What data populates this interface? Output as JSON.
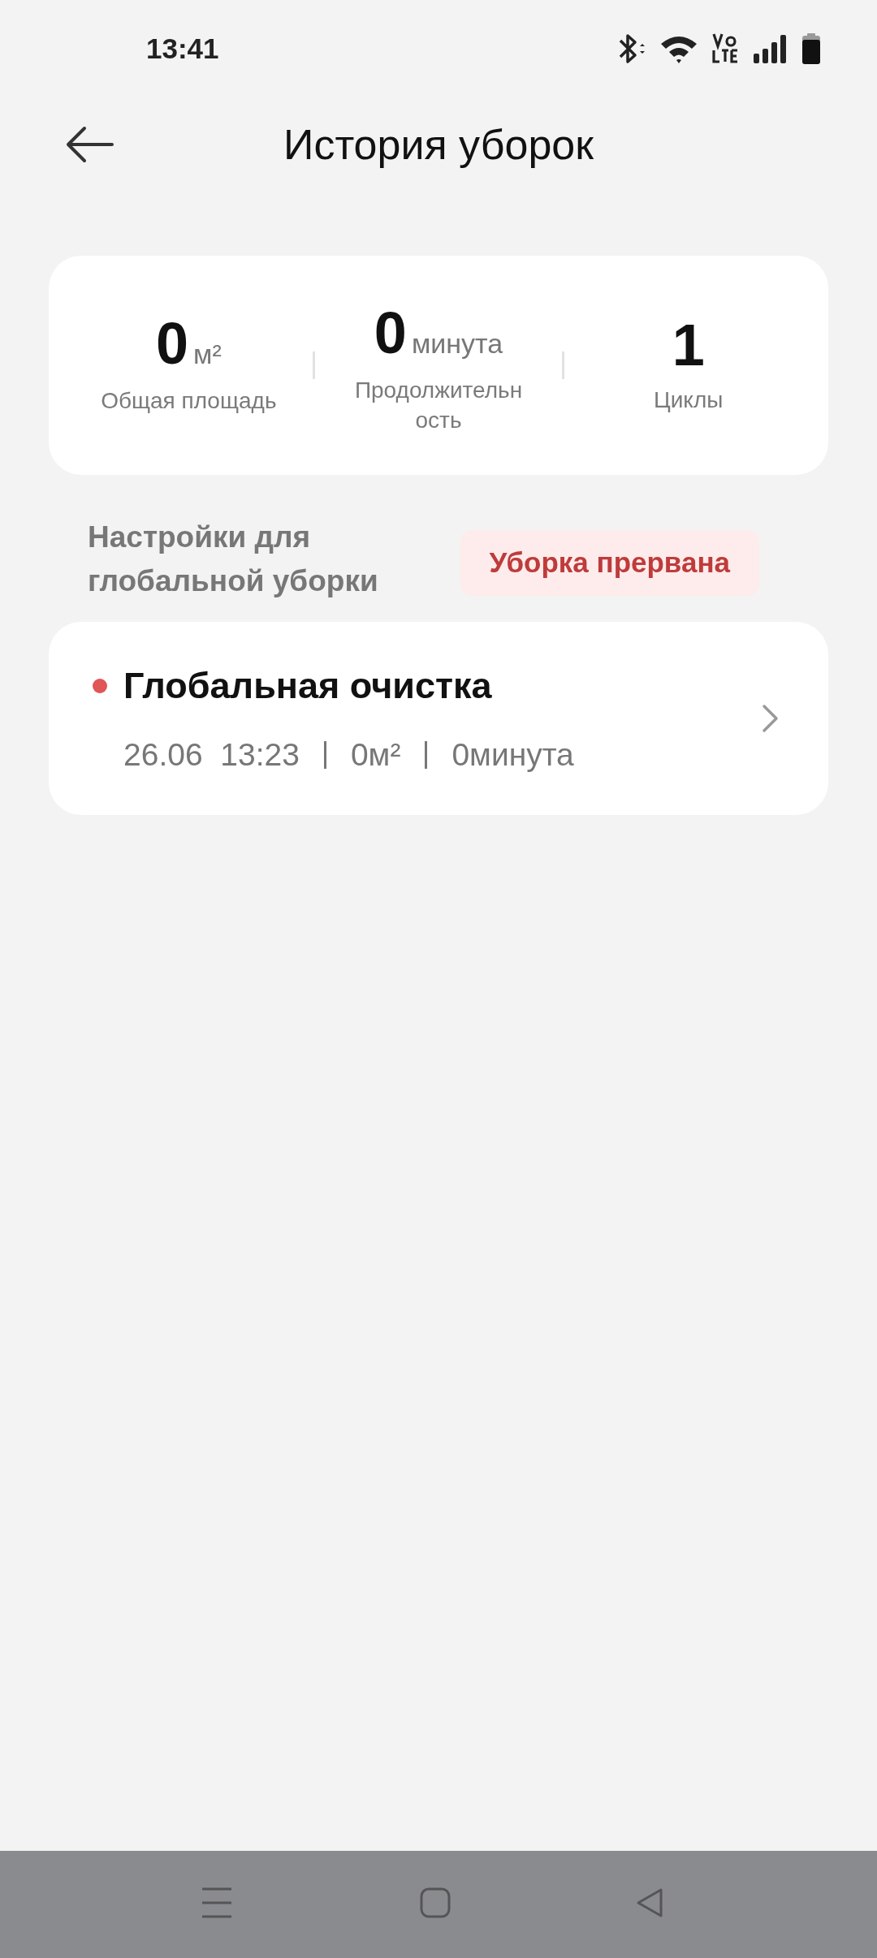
{
  "status_bar": {
    "time": "13:41"
  },
  "header": {
    "title": "История уборок"
  },
  "stats": [
    {
      "value": "0",
      "unit": "м²",
      "label": "Общая площадь"
    },
    {
      "value": "0",
      "unit": "минута",
      "label": "Продолжительн\nость"
    },
    {
      "value": "1",
      "label": "Циклы"
    }
  ],
  "section": {
    "title": "Настройки для\nглобальной уборки",
    "badge": "Уборка прервана"
  },
  "sessions": [
    {
      "title": "Глобальная очистка",
      "date_time": "26.06  13:23",
      "area": "0м²",
      "duration": "0минута",
      "color": "#e05555"
    }
  ]
}
